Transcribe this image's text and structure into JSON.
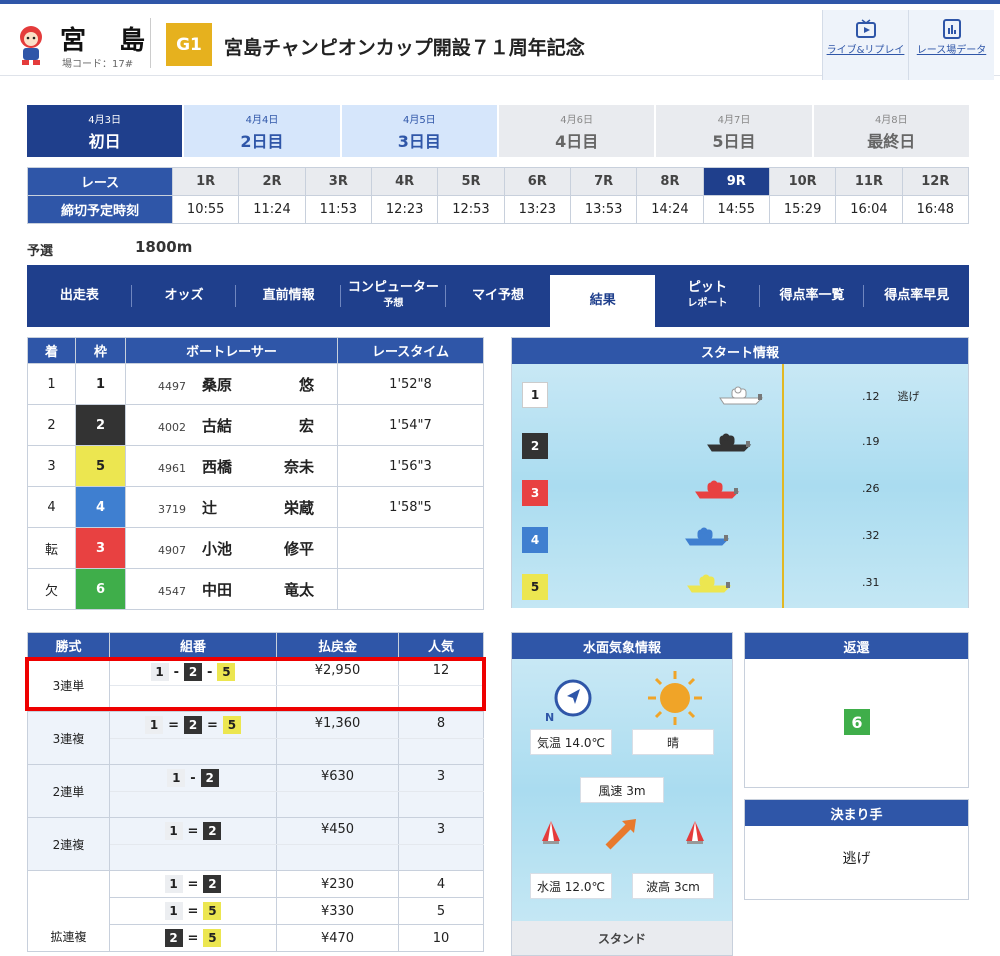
{
  "header": {
    "venue": "宮 島",
    "venue_code": "場コード：17#",
    "grade": "G1",
    "title": "宮島チャンピオンカップ開設７１周年記念",
    "btn_live": "ライブ&リプレイ",
    "btn_data": "レース場データ"
  },
  "days": [
    {
      "date": "4月3日",
      "label": "初日",
      "state": "active"
    },
    {
      "date": "4月4日",
      "label": "2日目",
      "state": "past"
    },
    {
      "date": "4月5日",
      "label": "3日目",
      "state": "past"
    },
    {
      "date": "4月6日",
      "label": "4日目",
      "state": "future"
    },
    {
      "date": "4月7日",
      "label": "5日目",
      "state": "future"
    },
    {
      "date": "4月8日",
      "label": "最終日",
      "state": "future"
    }
  ],
  "race_row": {
    "label": "レース",
    "time_label": "締切予定時刻",
    "races": [
      "1R",
      "2R",
      "3R",
      "4R",
      "5R",
      "6R",
      "7R",
      "8R",
      "9R",
      "10R",
      "11R",
      "12R"
    ],
    "times": [
      "10:55",
      "11:24",
      "11:53",
      "12:23",
      "12:53",
      "13:23",
      "13:53",
      "14:24",
      "14:55",
      "15:29",
      "16:04",
      "16:48"
    ],
    "active": "9R"
  },
  "race_class": "予選",
  "distance": "1800m",
  "nav": [
    {
      "label": "出走表",
      "sub": ""
    },
    {
      "label": "オッズ",
      "sub": ""
    },
    {
      "label": "直前情報",
      "sub": ""
    },
    {
      "label": "コンピューター",
      "sub": "予想"
    },
    {
      "label": "マイ予想",
      "sub": ""
    },
    {
      "label": "結果",
      "sub": "",
      "active": true
    },
    {
      "label": "ピット",
      "sub": "レポート"
    },
    {
      "label": "得点率一覧",
      "sub": ""
    },
    {
      "label": "得点率早見",
      "sub": ""
    }
  ],
  "results": {
    "headers": [
      "着",
      "枠",
      "ボートレーサー",
      "レースタイム"
    ],
    "rows": [
      {
        "place": "1",
        "waku": "1",
        "regno": "4497",
        "sei": "桑原",
        "mei": "悠",
        "time": "1'52\"8"
      },
      {
        "place": "2",
        "waku": "2",
        "regno": "4002",
        "sei": "古結",
        "mei": "宏",
        "time": "1'54\"7"
      },
      {
        "place": "3",
        "waku": "5",
        "regno": "4961",
        "sei": "西橋",
        "mei": "奈未",
        "time": "1'56\"3"
      },
      {
        "place": "4",
        "waku": "4",
        "regno": "3719",
        "sei": "辻",
        "mei": "栄蔵",
        "time": "1'58\"5"
      },
      {
        "place": "転",
        "waku": "3",
        "regno": "4907",
        "sei": "小池",
        "mei": "修平",
        "time": ""
      },
      {
        "place": "欠",
        "waku": "6",
        "regno": "4547",
        "sei": "中田",
        "mei": "竜太",
        "time": ""
      }
    ]
  },
  "start": {
    "title": "スタート情報",
    "boats": [
      {
        "waku": "1",
        "time": ".12",
        "note": "逃げ"
      },
      {
        "waku": "2",
        "time": ".19",
        "note": ""
      },
      {
        "waku": "3",
        "time": ".26",
        "note": ""
      },
      {
        "waku": "4",
        "time": ".32",
        "note": ""
      },
      {
        "waku": "5",
        "time": ".31",
        "note": ""
      }
    ]
  },
  "payout": {
    "headers": [
      "勝式",
      "組番",
      "払戻金",
      "人気"
    ],
    "rows": [
      {
        "type": "3連単",
        "combo": [
          "1",
          "-",
          "2",
          "-",
          "5"
        ],
        "amount": "¥2,950",
        "pop": "12"
      },
      {
        "type": "3連複",
        "combo": [
          "1",
          "=",
          "2",
          "=",
          "5"
        ],
        "amount": "¥1,360",
        "pop": "8"
      },
      {
        "type": "2連単",
        "combo": [
          "1",
          "-",
          "2"
        ],
        "amount": "¥630",
        "pop": "3"
      },
      {
        "type": "2連複",
        "combo": [
          "1",
          "=",
          "2"
        ],
        "amount": "¥450",
        "pop": "3"
      }
    ],
    "kakuren": {
      "type": "拡連複",
      "rows": [
        {
          "combo": [
            "1",
            "=",
            "2"
          ],
          "amount": "¥230",
          "pop": "4"
        },
        {
          "combo": [
            "1",
            "=",
            "5"
          ],
          "amount": "¥330",
          "pop": "5"
        },
        {
          "combo": [
            "2",
            "=",
            "5"
          ],
          "amount": "¥470",
          "pop": "10"
        }
      ]
    }
  },
  "weather": {
    "title": "水面気象情報",
    "temp": "気温 14.0℃",
    "condition": "晴",
    "wind": "風速 3m",
    "water_temp": "水温 12.0℃",
    "wave": "波高 3cm",
    "north": "N",
    "stand": "スタンド"
  },
  "refund": {
    "title": "返還",
    "waku": "6"
  },
  "kimarite": {
    "title": "決まり手",
    "value": "逃げ"
  },
  "colors": {
    "waku1": "#ffffff",
    "waku2": "#333333",
    "waku3": "#e84141",
    "waku4": "#3f7fd0",
    "waku5": "#ece650",
    "waku6": "#3fae4a"
  }
}
